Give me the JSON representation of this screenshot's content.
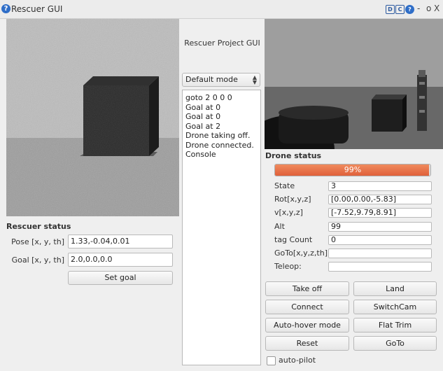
{
  "window": {
    "title": "Rescuer GUI",
    "controls": [
      "-",
      "o",
      "X"
    ]
  },
  "left": {
    "section_title": "Rescuer status",
    "pose_label": "Pose [x, y, th]",
    "pose_value": "1.33,-0.04,0.01",
    "goal_label": "Goal [x, y, th]",
    "goal_value": "2.0,0.0,0.0",
    "set_goal_label": "Set goal"
  },
  "center": {
    "project_title": "Rescuer Project GUI",
    "mode_selected": "Default mode",
    "console_lines": [
      "goto 2 0 0 0",
      "Goal at  0",
      "Goal at  0",
      "Goal at  2",
      "Drone taking off.",
      "Drone connected.",
      "Console"
    ]
  },
  "drone": {
    "section_title": "Drone status",
    "progress_text": "99%",
    "progress_value": 0.99,
    "fields": [
      {
        "label": "State",
        "value": "3"
      },
      {
        "label": "Rot[x,y,z]",
        "value": "[0.00,0.00,-5.83]"
      },
      {
        "label": "v[x,y,z]",
        "value": "[-7.52,9.79,8.91]"
      },
      {
        "label": "Alt",
        "value": "99"
      },
      {
        "label": "tag Count",
        "value": "0"
      },
      {
        "label": "GoTo[x,y,z,th]",
        "value": ""
      },
      {
        "label": "Teleop:",
        "value": ""
      }
    ],
    "buttons": {
      "take_off": "Take off",
      "land": "Land",
      "connect": "Connect",
      "switchcam": "SwitchCam",
      "auto_hover": "Auto-hover mode",
      "flat_trim": "Flat Trim",
      "reset": "Reset",
      "goto": "GoTo"
    },
    "auto_pilot_label": "auto-pilot",
    "auto_pilot_checked": false
  },
  "colors": {
    "progress_fill": "#e96a43",
    "title_icon": "#2f6ec8"
  }
}
